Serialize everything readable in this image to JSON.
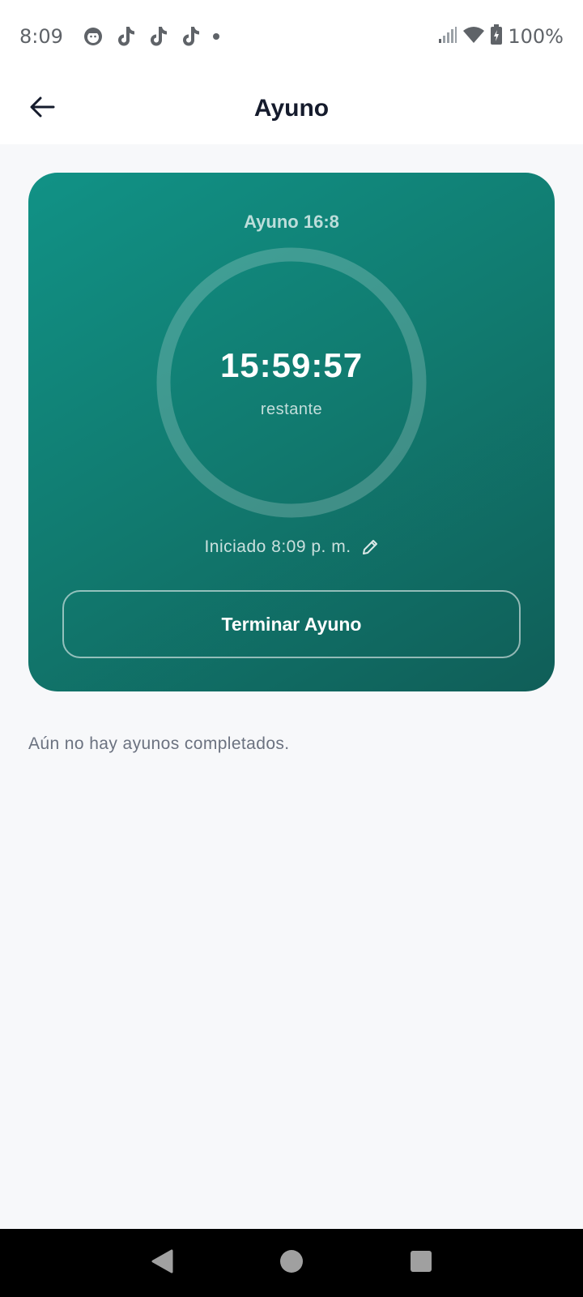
{
  "status_bar": {
    "time": "8:09",
    "notification_icons": [
      "face-icon",
      "tiktok-icon",
      "tiktok-icon",
      "tiktok-icon",
      "dot-icon"
    ],
    "battery": "100%"
  },
  "app_bar": {
    "title": "Ayuno"
  },
  "fast_card": {
    "plan": "Ayuno 16:8",
    "timer": "15:59:57",
    "timer_caption": "restante",
    "started": "Iniciado 8:09 p. m.",
    "end_button": "Terminar Ayuno",
    "progress": 0,
    "colors": {
      "gradient_start": "#119286",
      "gradient_end": "#105e58"
    }
  },
  "history": {
    "empty_message": "Aún no hay ayunos completados."
  }
}
